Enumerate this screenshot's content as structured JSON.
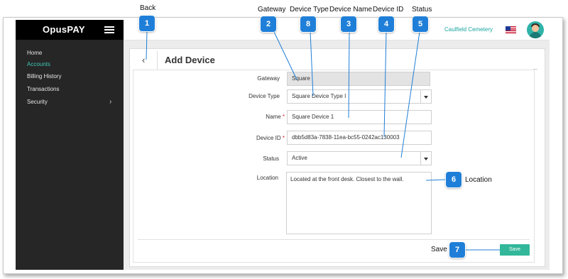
{
  "app": {
    "logo": "OpusPAY"
  },
  "sidebar": {
    "items": [
      {
        "label": "Home"
      },
      {
        "label": "Accounts"
      },
      {
        "label": "Billing History"
      },
      {
        "label": "Transactions"
      },
      {
        "label": "Security"
      }
    ]
  },
  "topbar": {
    "cemetery": "Caulfield Cemetery"
  },
  "page": {
    "title": "Add Device"
  },
  "form": {
    "gateway": {
      "label": "Gateway",
      "value": "Square"
    },
    "device_type": {
      "label": "Device Type",
      "value": "Square Device Type I"
    },
    "name": {
      "label": "Name",
      "required": "*",
      "value": "Square Device 1"
    },
    "device_id": {
      "label": "Device ID",
      "required": "*",
      "value": "dbb5d83a-7838-11ea-bc55-0242ac130003"
    },
    "status": {
      "label": "Status",
      "value": "Active"
    },
    "location": {
      "label": "Location",
      "value": "Located at the front desk. Closest to the wall."
    },
    "save_label": "Save"
  },
  "annotations": {
    "back": "Back",
    "gateway": "Gateway",
    "device_type": "Device Type",
    "device_name": "Device Name",
    "device_id": "Device ID",
    "status": "Status",
    "location": "Location",
    "save": "Save",
    "numbers": [
      "1",
      "2",
      "8",
      "3",
      "4",
      "5",
      "6",
      "7"
    ]
  },
  "colors": {
    "accent": "#3ec6b5",
    "callout": "#1f7fd8",
    "save": "#33b79a",
    "required": "#d9232d"
  }
}
